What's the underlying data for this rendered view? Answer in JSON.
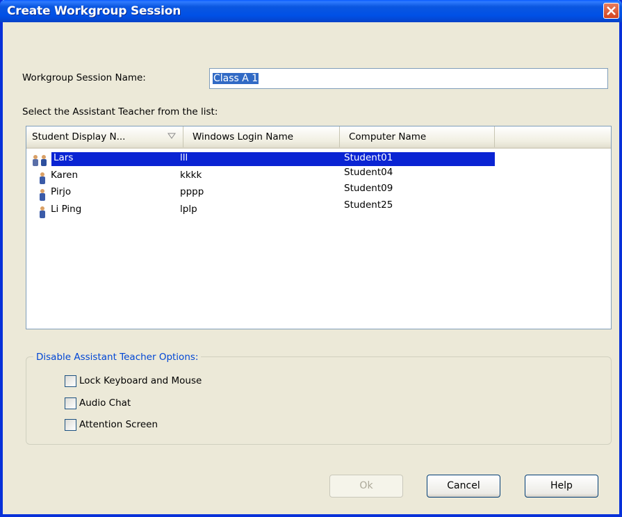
{
  "window": {
    "title": "Create Workgroup Session"
  },
  "form": {
    "session_name_label": "Workgroup Session Name:",
    "session_name_value": "Class A 1",
    "list_prompt": "Select the Assistant Teacher from the list:"
  },
  "list": {
    "columns": [
      "Student Display N...",
      "Windows Login Name",
      "Computer Name"
    ],
    "rows": [
      {
        "display_name": "Lars",
        "login": "lll",
        "computer": "Student01",
        "selected": true,
        "icon": "group-users-icon"
      },
      {
        "display_name": "Karen",
        "login": "kkkk",
        "computer": "Student04",
        "icon": "user-icon"
      },
      {
        "display_name": "Pirjo",
        "login": "pppp",
        "computer": "Student09",
        "icon": "user-icon"
      },
      {
        "display_name": "Li Ping",
        "login": "lplp",
        "computer": "Student25",
        "icon": "user-icon"
      }
    ]
  },
  "options": {
    "legend": "Disable Assistant Teacher Options:",
    "items": [
      {
        "label": "Lock Keyboard and Mouse",
        "checked": false
      },
      {
        "label": "Audio Chat",
        "checked": false
      },
      {
        "label": "Attention Screen",
        "checked": false
      }
    ]
  },
  "buttons": {
    "ok": "Ok",
    "ok_enabled": false,
    "cancel": "Cancel",
    "help": "Help"
  },
  "colors": {
    "title_bar": "#0050E6",
    "selection": "#0A24D3",
    "legend": "#0046D5",
    "dialog_bg": "#ECE9D8"
  }
}
